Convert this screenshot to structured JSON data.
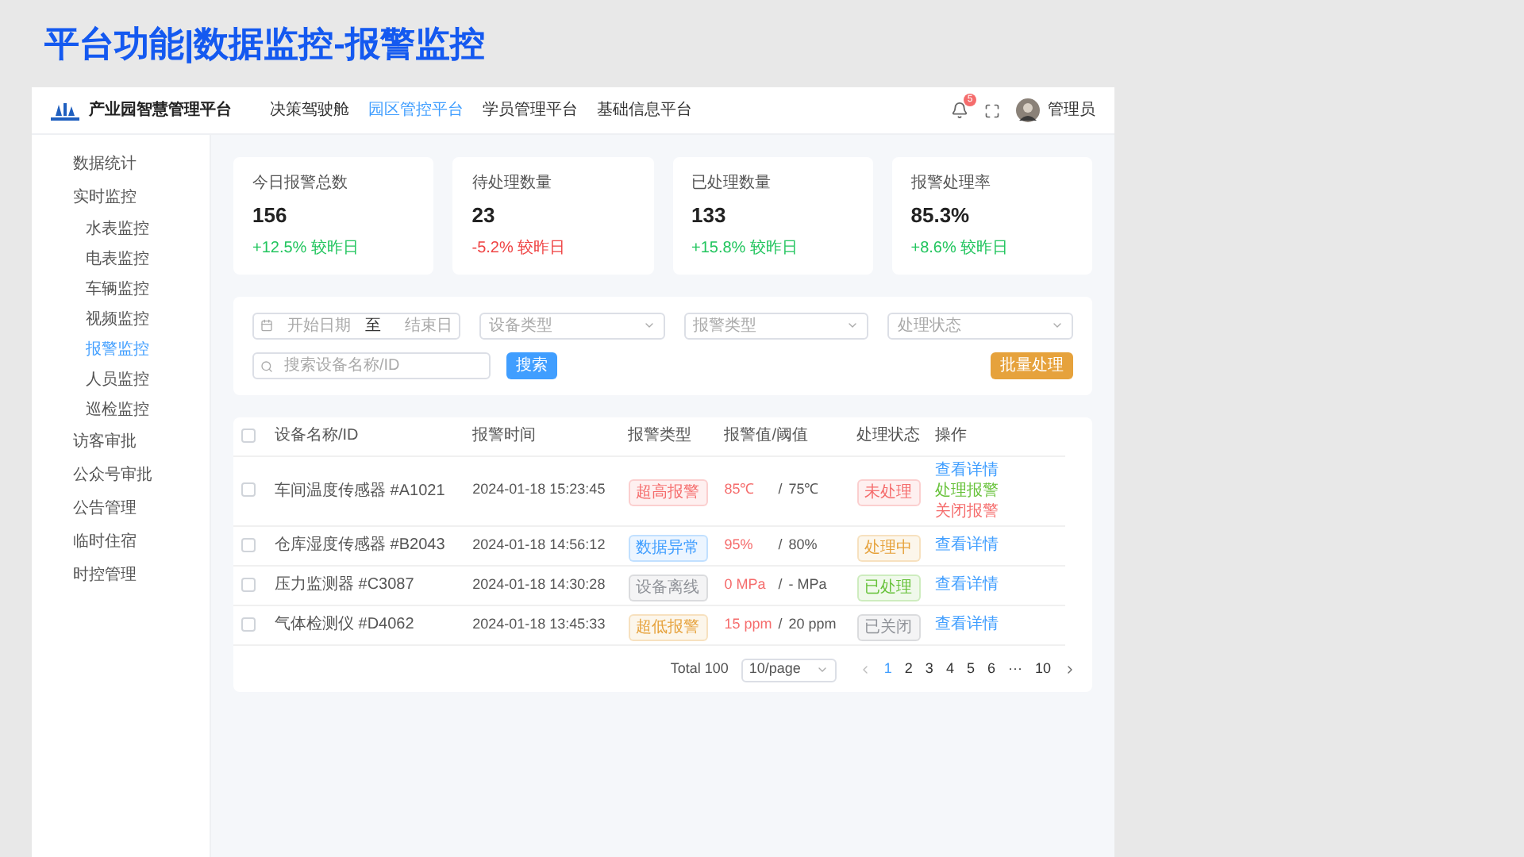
{
  "slide_title": "平台功能|数据监控-报警监控",
  "header": {
    "logo_text": "产业园智慧管理平台",
    "nav": [
      {
        "label": "决策驾驶舱",
        "selected": false
      },
      {
        "label": "园区管控平台",
        "selected": true
      },
      {
        "label": "学员管理平台",
        "selected": false
      },
      {
        "label": "基础信息平台",
        "selected": false
      }
    ],
    "badge": "5",
    "user": "管理员"
  },
  "sidebar": {
    "items": [
      {
        "label": "数据统计",
        "selected": false
      },
      {
        "label": "实时监控",
        "selected": false,
        "children": [
          {
            "label": "水表监控",
            "selected": false
          },
          {
            "label": "电表监控",
            "selected": false
          },
          {
            "label": "车辆监控",
            "selected": false
          },
          {
            "label": "视频监控",
            "selected": false
          },
          {
            "label": "报警监控",
            "selected": true
          },
          {
            "label": "人员监控",
            "selected": false
          },
          {
            "label": "巡检监控",
            "selected": false
          }
        ]
      },
      {
        "label": "访客审批",
        "selected": false
      },
      {
        "label": "公众号审批",
        "selected": false
      },
      {
        "label": "公告管理",
        "selected": false
      },
      {
        "label": "临时住宿",
        "selected": false
      },
      {
        "label": "时控管理",
        "selected": false
      }
    ]
  },
  "stats": [
    {
      "label": "今日报警总数",
      "value": "156",
      "change": "+12.5% 较昨日",
      "color": "#22c55e"
    },
    {
      "label": "待处理数量",
      "value": "23",
      "change": "-5.2% 较昨日",
      "color": "#ef4444"
    },
    {
      "label": "已处理数量",
      "value": "133",
      "change": "+15.8% 较昨日",
      "color": "#22c55e"
    },
    {
      "label": "报警处理率",
      "value": "85.3%",
      "change": "+8.6% 较昨日",
      "color": "#22c55e"
    }
  ],
  "filters": {
    "start_placeholder": "开始日期",
    "range_separator": "至",
    "end_placeholder": "结束日",
    "selects": [
      {
        "placeholder": "设备类型"
      },
      {
        "placeholder": "报警类型"
      },
      {
        "placeholder": "处理状态"
      }
    ],
    "search_placeholder": "搜索设备名称/ID",
    "search_button": "搜索",
    "batch_button": "批量处理"
  },
  "table": {
    "select_all_checked": false,
    "columns": [
      "设备名称/ID",
      "报警时间",
      "报警类型",
      "报警值/阈值",
      "处理状态",
      "操作"
    ],
    "rows": [
      {
        "checked": false,
        "device": "车间温度传感器 #A1021",
        "time": "2024-01-18 15:23:45",
        "type": {
          "label": "超高报警",
          "color": "#f56c6c"
        },
        "value": "85℃",
        "separator": "/",
        "threshold": "75℃",
        "status": {
          "label": "未处理",
          "color": "#f56c6c"
        },
        "actions": [
          {
            "label": "查看详情",
            "kind": "detail"
          },
          {
            "label": "处理报警",
            "kind": "handle"
          },
          {
            "label": "关闭报警",
            "kind": "close"
          }
        ]
      },
      {
        "checked": false,
        "device": "仓库湿度传感器 #B2043",
        "time": "2024-01-18 14:56:12",
        "type": {
          "label": "数据异常",
          "color": "#409eff"
        },
        "value": "95%",
        "separator": "/",
        "threshold": "80%",
        "status": {
          "label": "处理中",
          "color": "#e6a23c"
        },
        "actions": [
          {
            "label": "查看详情",
            "kind": "detail"
          }
        ]
      },
      {
        "checked": false,
        "device": "压力监测器 #C3087",
        "time": "2024-01-18 14:30:28",
        "type": {
          "label": "设备离线",
          "color": "#909399"
        },
        "value": "0 MPa",
        "separator": "/",
        "threshold": "- MPa",
        "status": {
          "label": "已处理",
          "color": "#67c23a"
        },
        "actions": [
          {
            "label": "查看详情",
            "kind": "detail"
          }
        ]
      },
      {
        "checked": false,
        "device": "气体检测仪 #D4062",
        "time": "2024-01-18 13:45:33",
        "type": {
          "label": "超低报警",
          "color": "#e6a23c"
        },
        "value": "15 ppm",
        "separator": "/",
        "threshold": "20 ppm",
        "status": {
          "label": "已关闭",
          "color": "#909399"
        },
        "actions": [
          {
            "label": "查看详情",
            "kind": "detail"
          }
        ]
      }
    ]
  },
  "pagination": {
    "total": "Total 100",
    "page_size": "10/page",
    "pages": [
      {
        "label": "1",
        "selected": true
      },
      {
        "label": "2",
        "selected": false
      },
      {
        "label": "3",
        "selected": false
      },
      {
        "label": "4",
        "selected": false
      },
      {
        "label": "5",
        "selected": false
      },
      {
        "label": "6",
        "selected": false
      },
      {
        "label": "···",
        "selected": false
      },
      {
        "label": "10",
        "selected": false
      }
    ]
  }
}
